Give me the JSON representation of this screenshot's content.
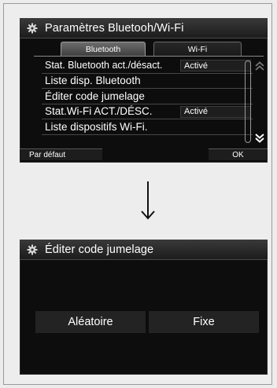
{
  "screen1": {
    "title": "Paramètres Bluetooh/Wi-Fi",
    "tabs": [
      {
        "label": "Bluetooth",
        "active": true
      },
      {
        "label": "Wi-Fi",
        "active": false
      }
    ],
    "rows": [
      {
        "label": "Stat. Bluetooth act./désact.",
        "value": "Activé"
      },
      {
        "label": "Liste disp. Bluetooth",
        "value": ""
      },
      {
        "label": "Éditer code jumelage",
        "value": ""
      },
      {
        "label": "Stat.Wi-Fi ACT./DÉSC.",
        "value": "Activé"
      },
      {
        "label": "Liste dispositifs Wi-Fi.",
        "value": ""
      }
    ],
    "buttons": {
      "default_label": "Par défaut",
      "ok_label": "OK"
    },
    "icons": {
      "title": "gear-icon",
      "scroll_up": "double-chevron-up-icon",
      "scroll_down": "double-chevron-down-icon"
    }
  },
  "transition": {
    "icon": "down-arrow-icon"
  },
  "screen2": {
    "title": "Éditer code jumelage",
    "options": {
      "random_label": "Aléatoire",
      "fixed_label": "Fixe"
    },
    "icons": {
      "title": "gear-icon"
    }
  },
  "colors": {
    "screen_bg": "#0d0d0d",
    "page_bg": "#ececec",
    "text": "#ffffff"
  }
}
